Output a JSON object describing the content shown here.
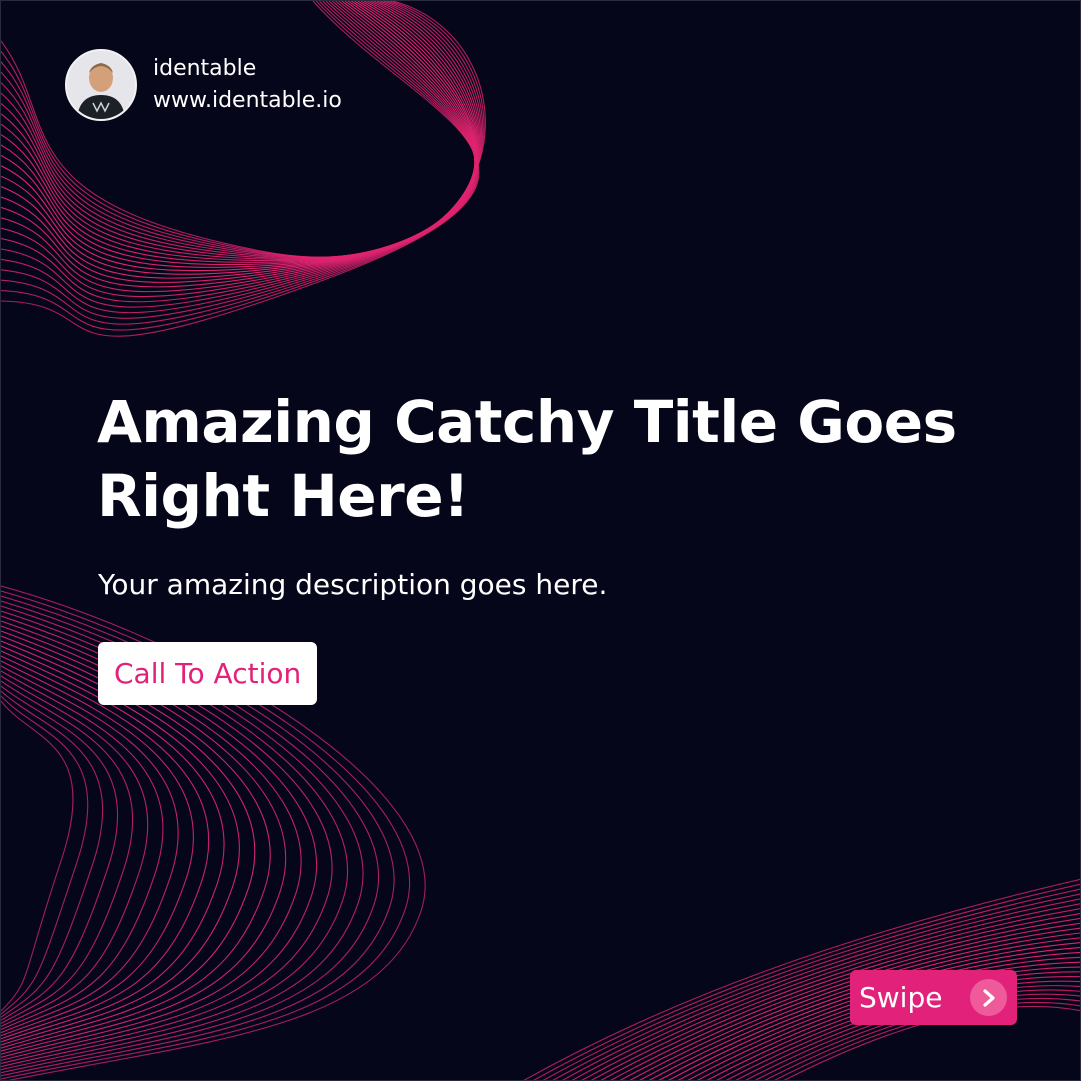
{
  "profile": {
    "name": "identable",
    "url": "www.identable.io"
  },
  "headline": {
    "line1": "Amazing Catchy Title Goes",
    "line2": "Right Here!"
  },
  "description": "Your amazing description goes here.",
  "cta": {
    "label": "Call To Action"
  },
  "swipe": {
    "label": "Swipe",
    "icon": "chevron-right-icon"
  },
  "colors": {
    "background": "#05061a",
    "accent": "#e2217a",
    "text": "#ffffff"
  }
}
